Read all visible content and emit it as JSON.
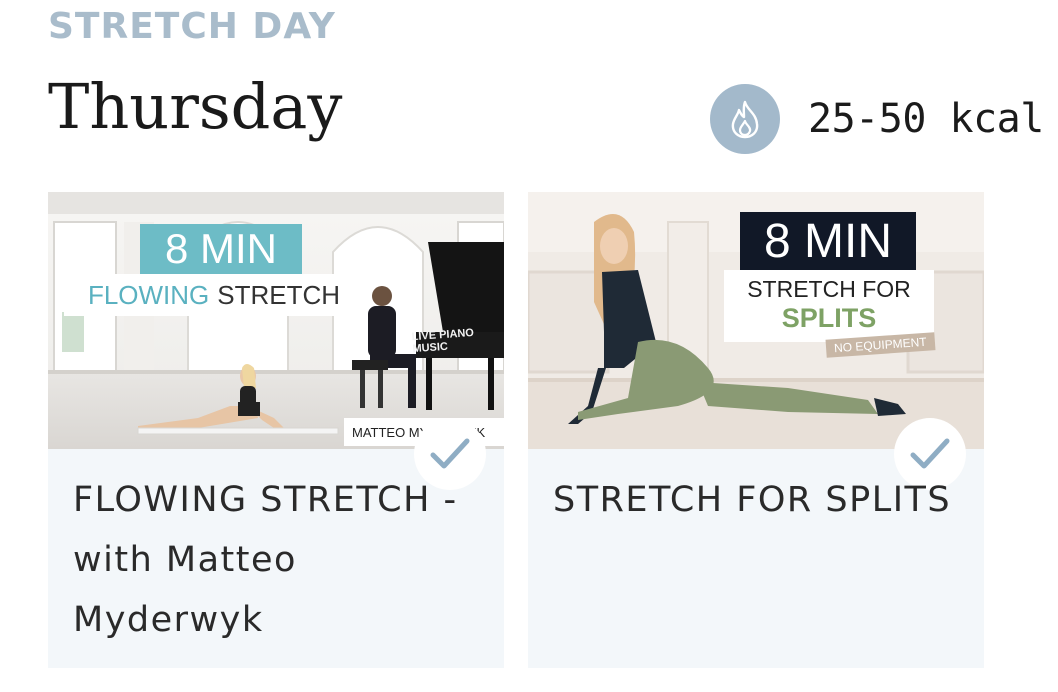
{
  "header": {
    "kicker": "STRETCH DAY",
    "day": "Thursday",
    "calories": "25-50 kcal",
    "calories_icon": "flame-icon"
  },
  "colors": {
    "accent": "#a3b9cb",
    "card_bg": "#f3f7fa",
    "check": "#8fadc4"
  },
  "cards": [
    {
      "title": "FLOWING STRETCH - with Matteo Myderwyk",
      "completed": true,
      "thumb": {
        "duration": "8 MIN",
        "line_a": "FLOWING",
        "line_b": "STRETCH",
        "tag": "LIVE PIANO MUSIC",
        "credit": "MATTEO MYDERWYK"
      }
    },
    {
      "title": "STRETCH FOR SPLITS",
      "completed": true,
      "thumb": {
        "duration": "8 MIN",
        "line_a": "STRETCH FOR",
        "line_b": "SPLITS",
        "tag": "NO EQUIPMENT"
      }
    }
  ]
}
